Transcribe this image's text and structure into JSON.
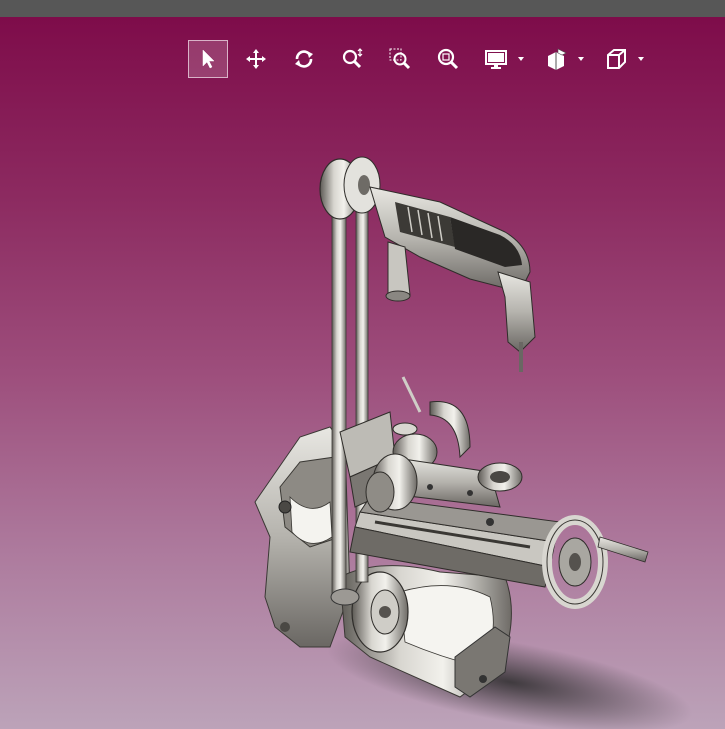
{
  "window": {
    "titlebar_color": "#575757"
  },
  "viewport": {
    "background_top": "#7e0c4a",
    "background_bottom": "#bca3b9",
    "model": "drill-press-on-workholding-fixture"
  },
  "toolbar": {
    "tools": [
      {
        "icon": "select-arrow-icon",
        "active": true
      },
      {
        "icon": "pan-move-icon",
        "active": false
      },
      {
        "icon": "rotate-icon",
        "active": false
      },
      {
        "icon": "zoom-in-out-icon",
        "active": false
      },
      {
        "icon": "zoom-window-icon",
        "active": false
      },
      {
        "icon": "zoom-fit-icon",
        "active": false
      },
      {
        "icon": "display-mode-icon",
        "active": false,
        "dropdown": true
      },
      {
        "icon": "section-view-icon",
        "active": false,
        "dropdown": true
      },
      {
        "icon": "view-orientation-cube-icon",
        "active": false,
        "dropdown": true
      }
    ]
  }
}
